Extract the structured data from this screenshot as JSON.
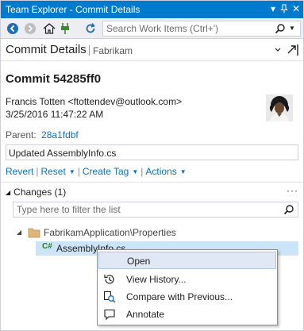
{
  "window": {
    "title": "Team Explorer - Commit Details"
  },
  "toolbar": {
    "search_placeholder": "Search Work Items (Ctrl+')"
  },
  "header": {
    "title": "Commit Details",
    "subtitle": "Fabrikam"
  },
  "commit": {
    "title": "Commit 54285ff0",
    "author": "Francis Totten <ftottendev@outlook.com>",
    "date": "3/25/2016 11:47:22 AM",
    "parent_label": "Parent:",
    "parent_hash": "28a1fdbf",
    "message": "Updated AssemblyInfo.cs"
  },
  "actions": [
    {
      "label": "Revert"
    },
    {
      "label": "Reset"
    },
    {
      "label": "Create Tag"
    },
    {
      "label": "Actions"
    }
  ],
  "changes": {
    "heading": "Changes (1)",
    "more": "···",
    "filter_placeholder": "Type here to filter the list",
    "folder": "FabrikamApplication\\Properties",
    "file": "AssemblyInfo.cs"
  },
  "context_menu": [
    {
      "label": "Open",
      "icon": "open-icon"
    },
    {
      "label": "View History...",
      "icon": "history-icon"
    },
    {
      "label": "Compare with Previous...",
      "icon": "compare-icon"
    },
    {
      "label": "Annotate",
      "icon": "annotate-icon"
    }
  ],
  "colors": {
    "titlebar": "#007acc",
    "link": "#0e70c0",
    "selection": "#cce4f7",
    "menu_highlight": "#e0e8f5"
  }
}
